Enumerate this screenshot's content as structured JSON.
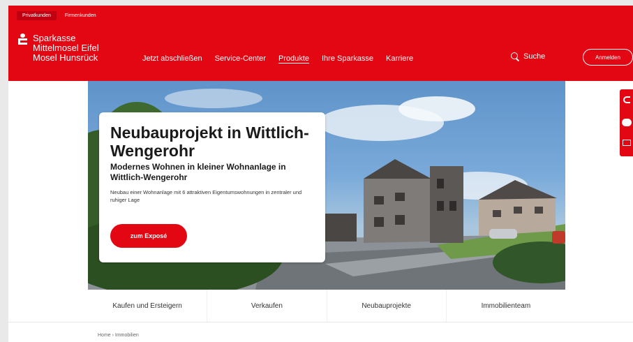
{
  "header": {
    "segments": [
      "Privatkunden",
      "Firmenkunden"
    ],
    "logo_lines": [
      "Sparkasse",
      "Mittelmosel Eifel",
      "Mosel Hunsrück"
    ],
    "nav": [
      "Jetzt abschließen",
      "Service-Center",
      "Produkte",
      "Ihre Sparkasse",
      "Karriere"
    ],
    "active_nav": "Produkte",
    "search_label": "Suche",
    "login_label": "Anmelden",
    "icons": {
      "search": "search-icon",
      "logo": "sparkasse-logo-icon"
    }
  },
  "hero": {
    "title": "Neubauprojekt in Wittlich-Wengerohr",
    "subtitle": "Modernes Wohnen in kleiner Wohnanlage in Wittlich-Wengerohr",
    "description": "Neubau einer Wohnanlage mit 6 attraktiven Eigentumswohnungen in zentraler und ruhiger Lage",
    "cta_label": "zum Exposé"
  },
  "subnav": [
    "Kaufen und Ersteigern",
    "Verkaufen",
    "Neubauprojekte",
    "Immobilienteam"
  ],
  "breadcrumb": "Home › Immobilien",
  "side_widget_icons": [
    "phone-icon",
    "chat-icon",
    "mail-icon"
  ],
  "colors": {
    "brand": "#e30613",
    "white": "#ffffff"
  }
}
